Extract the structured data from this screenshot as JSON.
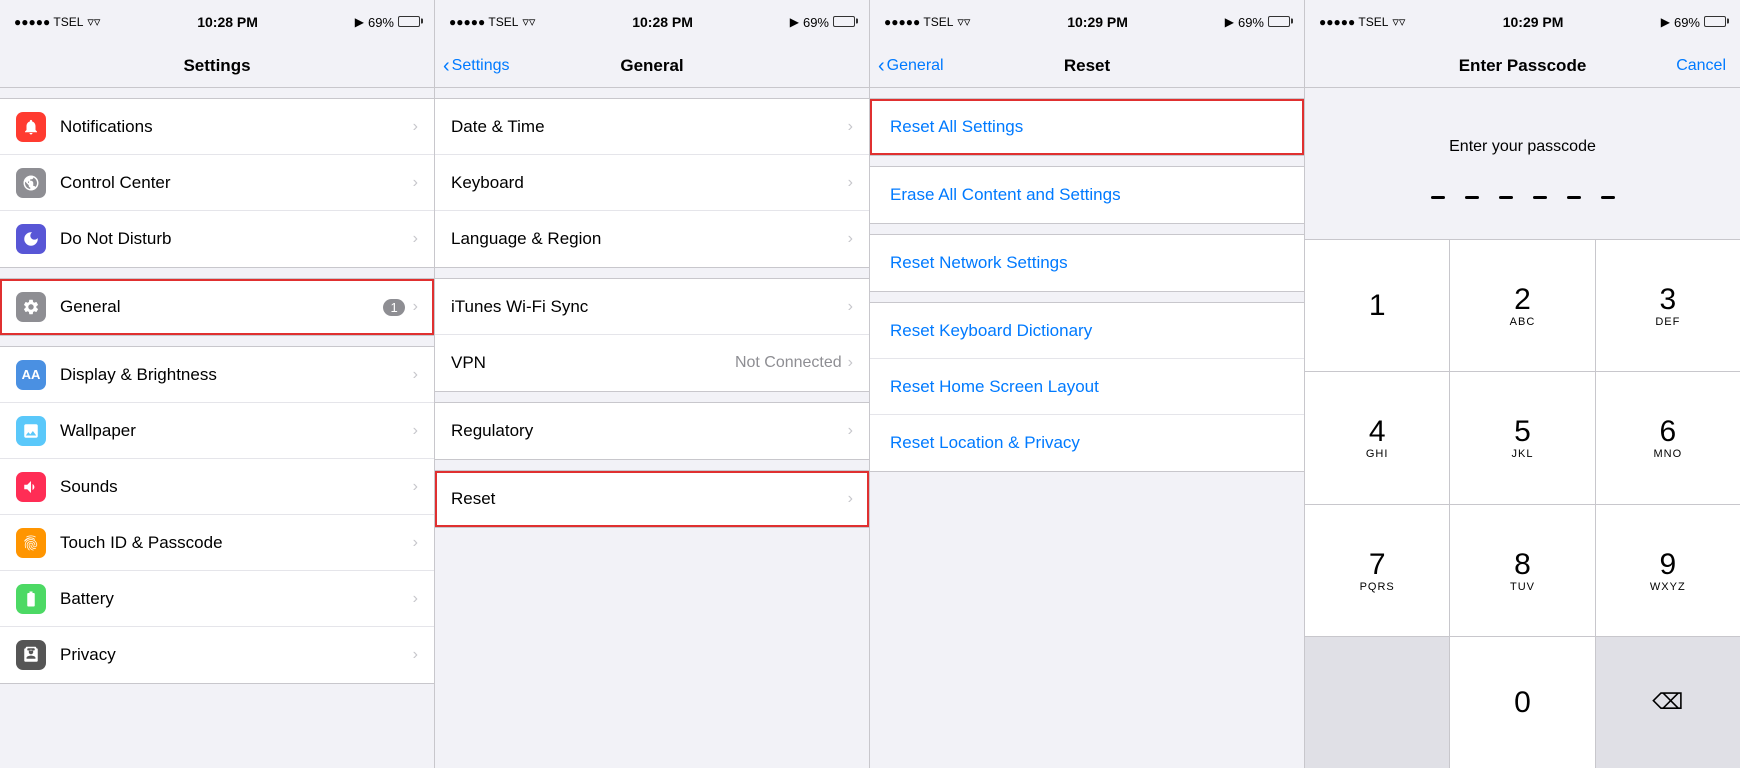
{
  "panels": [
    {
      "id": "settings",
      "statusBar": {
        "carrier": "●●●●● TSEL",
        "wifi": true,
        "time": "10:28 PM",
        "location": true,
        "battery": "69%"
      },
      "title": "Settings",
      "items": [
        {
          "id": "notifications",
          "icon": "🔔",
          "iconColor": "icon-notifications",
          "label": "Notifications",
          "badge": null
        },
        {
          "id": "control-center",
          "icon": "⊞",
          "iconColor": "icon-control",
          "label": "Control Center",
          "badge": null
        },
        {
          "id": "do-not-disturb",
          "icon": "🌙",
          "iconColor": "icon-dnd",
          "label": "Do Not Disturb",
          "badge": null
        },
        {
          "id": "general",
          "icon": "⚙",
          "iconColor": "icon-general",
          "label": "General",
          "badge": "1",
          "highlighted": true
        },
        {
          "id": "display",
          "icon": "AA",
          "iconColor": "icon-display",
          "label": "Display & Brightness",
          "badge": null
        },
        {
          "id": "wallpaper",
          "icon": "✦",
          "iconColor": "icon-wallpaper",
          "label": "Wallpaper",
          "badge": null
        },
        {
          "id": "sounds",
          "icon": "🔈",
          "iconColor": "icon-sounds",
          "label": "Sounds",
          "badge": null
        },
        {
          "id": "touchid",
          "icon": "◉",
          "iconColor": "icon-touchid",
          "label": "Touch ID & Passcode",
          "badge": null
        },
        {
          "id": "battery",
          "icon": "▪",
          "iconColor": "icon-battery",
          "label": "Battery",
          "badge": null
        },
        {
          "id": "privacy",
          "icon": "✋",
          "iconColor": "icon-privacy",
          "label": "Privacy",
          "badge": null
        }
      ]
    },
    {
      "id": "general",
      "statusBar": {
        "carrier": "●●●●● TSEL",
        "wifi": true,
        "time": "10:28 PM",
        "location": true,
        "battery": "69%"
      },
      "backLabel": "Settings",
      "title": "General",
      "items": [
        {
          "id": "datetime",
          "label": "Date & Time",
          "secondary": null
        },
        {
          "id": "keyboard",
          "label": "Keyboard",
          "secondary": null
        },
        {
          "id": "language",
          "label": "Language & Region",
          "secondary": null
        },
        {
          "id": "itunes",
          "label": "iTunes Wi-Fi Sync",
          "secondary": null
        },
        {
          "id": "vpn",
          "label": "VPN",
          "secondary": "Not Connected"
        },
        {
          "id": "regulatory",
          "label": "Regulatory",
          "secondary": null
        },
        {
          "id": "reset",
          "label": "Reset",
          "secondary": null,
          "highlighted": true
        }
      ]
    },
    {
      "id": "reset",
      "statusBar": {
        "carrier": "●●●●● TSEL",
        "wifi": true,
        "time": "10:29 PM",
        "location": true,
        "battery": "69%"
      },
      "backLabel": "General",
      "title": "Reset",
      "items": [
        {
          "id": "reset-all",
          "label": "Reset All Settings",
          "highlighted": true
        },
        {
          "id": "erase-all",
          "label": "Erase All Content and Settings"
        },
        {
          "id": "reset-network",
          "label": "Reset Network Settings"
        },
        {
          "id": "reset-keyboard",
          "label": "Reset Keyboard Dictionary"
        },
        {
          "id": "reset-home",
          "label": "Reset Home Screen Layout"
        },
        {
          "id": "reset-location",
          "label": "Reset Location & Privacy"
        }
      ]
    },
    {
      "id": "passcode",
      "statusBar": {
        "carrier": "●●●●● TSEL",
        "wifi": true,
        "time": "10:29 PM",
        "location": true,
        "battery": "69%"
      },
      "title": "Enter Passcode",
      "cancelLabel": "Cancel",
      "prompt": "Enter your passcode",
      "dots": 6,
      "numpad": [
        [
          {
            "digit": "1",
            "letters": ""
          },
          {
            "digit": "2",
            "letters": "ABC"
          },
          {
            "digit": "3",
            "letters": "DEF"
          }
        ],
        [
          {
            "digit": "4",
            "letters": "GHI"
          },
          {
            "digit": "5",
            "letters": "JKL"
          },
          {
            "digit": "6",
            "letters": "MNO"
          }
        ],
        [
          {
            "digit": "7",
            "letters": "PQRS"
          },
          {
            "digit": "8",
            "letters": "TUV"
          },
          {
            "digit": "9",
            "letters": "WXYZ"
          }
        ],
        [
          {
            "digit": "",
            "letters": "",
            "type": "empty"
          },
          {
            "digit": "0",
            "letters": ""
          },
          {
            "digit": "⌫",
            "letters": "",
            "type": "delete"
          }
        ]
      ]
    }
  ]
}
